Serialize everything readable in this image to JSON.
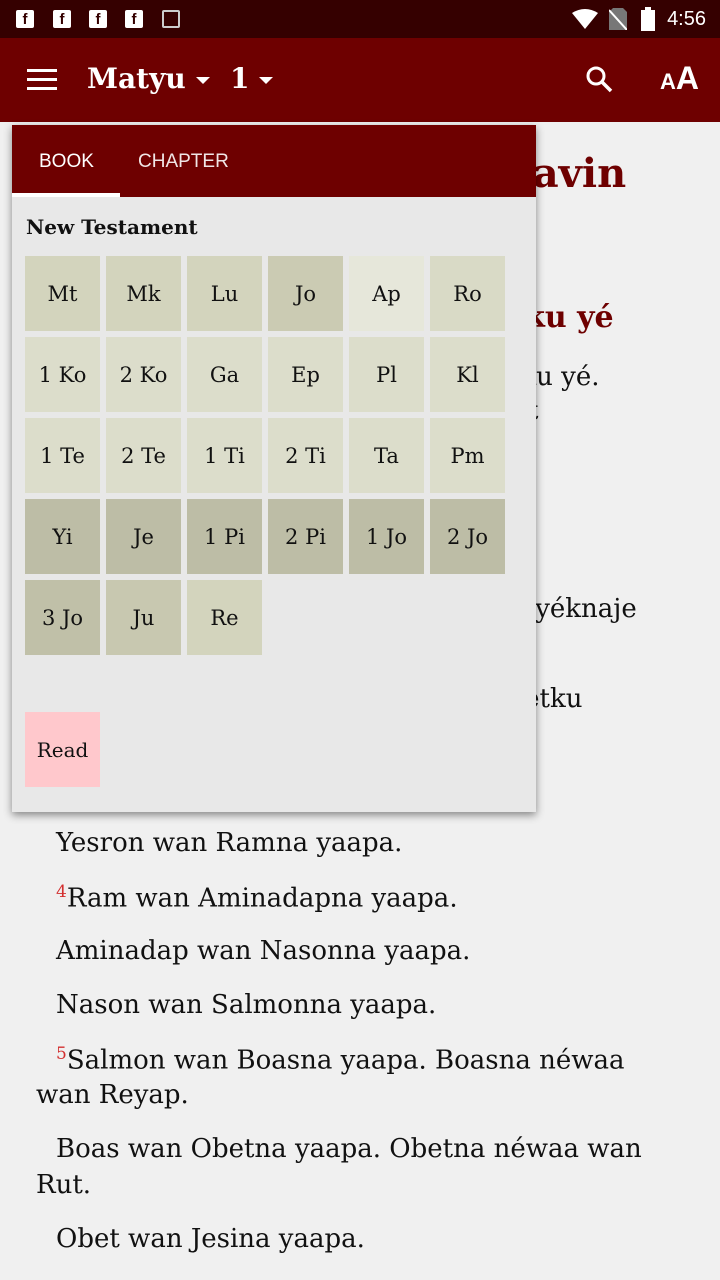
{
  "status_bar": {
    "time": "4:56",
    "notification_icons": [
      "facebook-icon",
      "facebook-icon",
      "facebook-icon",
      "facebook-icon",
      "image-icon"
    ],
    "system_icons": [
      "wifi-icon",
      "no-sim-icon",
      "battery-icon"
    ]
  },
  "app_bar": {
    "book": "Matyu",
    "chapter": "1",
    "icons": [
      "menu-icon",
      "search-icon",
      "text-size-icon"
    ],
    "text_size_label": "A"
  },
  "colors": {
    "primary": "#6e0000",
    "status": "#350000",
    "read_button": "#ffc8cc",
    "verse_number": "#d32f2f"
  },
  "background_text": [
    {
      "text": "kavin",
      "heading": true
    },
    {
      "text": "eku yé",
      "heading": true
    },
    {
      "text": "eku yé."
    },
    {
      "text": "vit"
    },
    {
      "text": "vayéknaje"
    },
    {
      "text": "Bétku"
    }
  ],
  "verses": [
    {
      "num": "",
      "text": "Yesron wan Ramna yaapa."
    },
    {
      "num": "4",
      "text": "Ram wan Aminadapna yaapa."
    },
    {
      "num": "",
      "text": "Aminadap wan Nasonna yaapa."
    },
    {
      "num": "",
      "text": "Nason wan Salmonna yaapa."
    },
    {
      "num": "5",
      "text": "Salmon wan Boasna yaapa. Boasna néwaa",
      "cont": "wan Reyap."
    },
    {
      "num": "",
      "text": "Boas wan Obetna yaapa. Obetna néwaa wan",
      "cont": "Rut."
    },
    {
      "num": "",
      "text": "Obet wan Jesina yaapa."
    }
  ],
  "popup": {
    "tabs": [
      "BOOK",
      "CHAPTER"
    ],
    "active_tab": "BOOK",
    "section": "New Testament",
    "read_label": "Read",
    "books": [
      "Mt",
      "Mk",
      "Lu",
      "Jo",
      "Ap",
      "Ro",
      "1 Ko",
      "2 Ko",
      "Ga",
      "Ep",
      "Pl",
      "Kl",
      "1 Te",
      "2 Te",
      "1 Ti",
      "2 Ti",
      "Ta",
      "Pm",
      "Yi",
      "Je",
      "1 Pi",
      "2 Pi",
      "1 Jo",
      "2 Jo",
      "3 Jo",
      "Ju",
      "Re"
    ],
    "book_colors": [
      "#d3d4bd",
      "#d3d4bd",
      "#d3d4bd",
      "#cbcbb3",
      "#e6e7da",
      "#d9dac6",
      "#dcddcb",
      "#dcddcb",
      "#dcddcb",
      "#dcddcb",
      "#dcddcb",
      "#dcddcb",
      "#dcddcb",
      "#dcddcb",
      "#dcddcb",
      "#dcddcb",
      "#dcddcb",
      "#dcddcb",
      "#bdbda6",
      "#bdbda6",
      "#bdbda6",
      "#bdbda6",
      "#bdbda6",
      "#bdbda6",
      "#c0c0a8",
      "#c8c8b0",
      "#d3d4bd"
    ]
  }
}
